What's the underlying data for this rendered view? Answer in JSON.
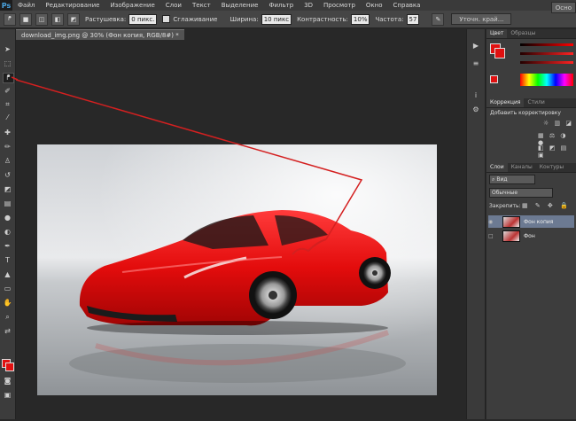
{
  "menubar": {
    "logo": "Ps",
    "items": [
      "Файл",
      "Редактирование",
      "Изображение",
      "Слои",
      "Текст",
      "Выделение",
      "Фильтр",
      "3D",
      "Просмотр",
      "Окно",
      "Справка"
    ]
  },
  "options": {
    "feather_label": "Растушевка:",
    "feather_value": "0 пикс.",
    "antialias_label": "Сглаживание",
    "width_label": "Ширина:",
    "width_value": "10 пикс",
    "contrast_label": "Контрастность:",
    "contrast_value": "10%",
    "frequency_label": "Частота:",
    "frequency_value": "57",
    "refine_label": "Уточн. край...",
    "workspace_label": "Осно"
  },
  "document": {
    "tab_title": "download_img.png @ 30% (Фон копия, RGB/8#) *"
  },
  "panels": {
    "color_tabs": [
      "Цвет",
      "Образцы"
    ],
    "correction_tabs": [
      "Коррекция",
      "Стили"
    ],
    "correction_hint": "Добавить корректировку",
    "layer_tabs": [
      "Слои",
      "Каналы",
      "Контуры"
    ],
    "kind_label": "Вид",
    "blend_mode": "Обычные",
    "lock_label": "Закрепить:",
    "layers": [
      {
        "name": "Фон копия",
        "selected": true
      },
      {
        "name": "Фон",
        "selected": false
      }
    ]
  },
  "colors": {
    "foreground": "#e01010",
    "background": "#e01010",
    "annotation": "#d42020"
  }
}
